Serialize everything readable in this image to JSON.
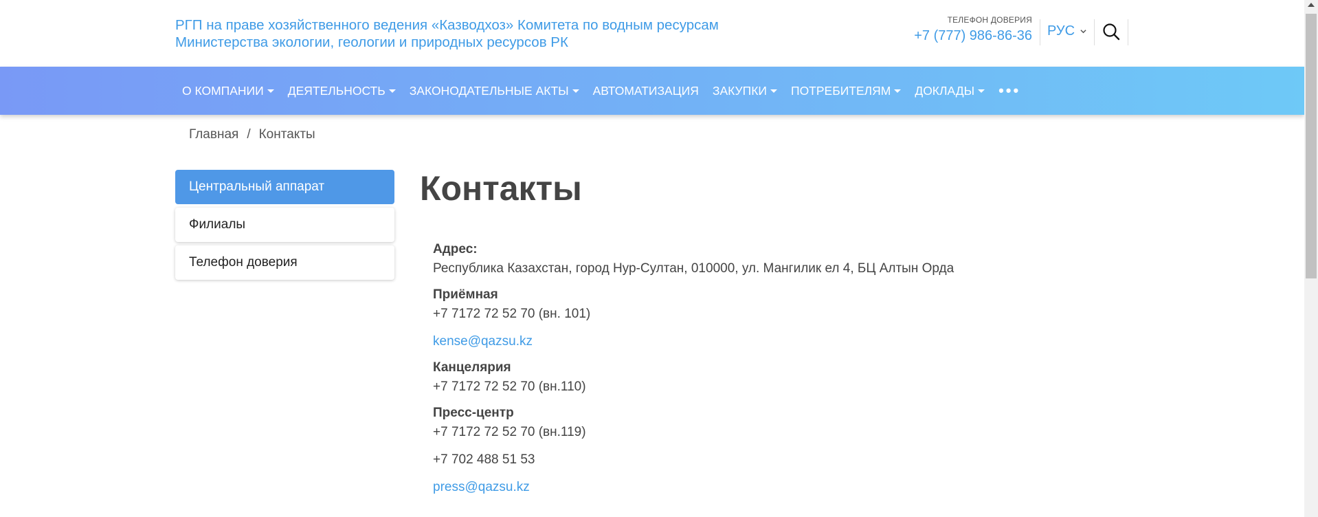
{
  "header": {
    "org_line1": "РГП на праве хозяйственного ведения «Казводхоз» Комитета по водным ресурсам",
    "org_line2": "Министерства экологии, геологии и природных ресурсов РК",
    "hotline_label": "ТЕЛЕФОН ДОВЕРИЯ",
    "hotline_phone": "+7 (777) 986-86-36",
    "language": "РУС",
    "search_icon": "search-icon"
  },
  "nav": {
    "items": [
      {
        "label": "О КОМПАНИИ",
        "dropdown": true
      },
      {
        "label": "ДЕЯТЕЛЬНОСТЬ",
        "dropdown": true
      },
      {
        "label": "ЗАКОНОДАТЕЛЬНЫЕ АКТЫ",
        "dropdown": true
      },
      {
        "label": "АВТОМАТИЗАЦИЯ",
        "dropdown": false
      },
      {
        "label": "ЗАКУПКИ",
        "dropdown": true
      },
      {
        "label": "ПОТРЕБИТЕЛЯМ",
        "dropdown": true
      },
      {
        "label": "ДОКЛАДЫ",
        "dropdown": true
      }
    ],
    "more": "•••"
  },
  "breadcrumb": {
    "home": "Главная",
    "separator": "/",
    "current": "Контакты"
  },
  "sidebar": {
    "items": [
      {
        "label": "Центральный аппарат",
        "active": true
      },
      {
        "label": "Филиалы",
        "active": false
      },
      {
        "label": "Телефон доверия",
        "active": false
      }
    ]
  },
  "main": {
    "title": "Контакты",
    "address_label": "Адрес:",
    "address": "Республика Казахстан, город Нур-Султан, 010000, ул. Мангилик ел 4, БЦ Алтын Орда",
    "reception_label": "Приёмная",
    "reception_phone": "+7 7172 72 52 70 (вн. 101)",
    "reception_email": "kense@qazsu.kz",
    "office_label": "Канцелярия",
    "office_phone": "+7 7172 72 52 70 (вн.110)",
    "press_label": "Пресс-центр",
    "press_phone": "+7 7172 72 52 70 (вн.119)",
    "press_mobile": "+7 702 488 51 53",
    "press_email": "press@qazsu.kz"
  },
  "colors": {
    "accent": "#3f9be6",
    "nav_gradient_start": "#7999f6",
    "nav_gradient_end": "#6ec9f7",
    "sidebar_active": "#4f98e7"
  }
}
